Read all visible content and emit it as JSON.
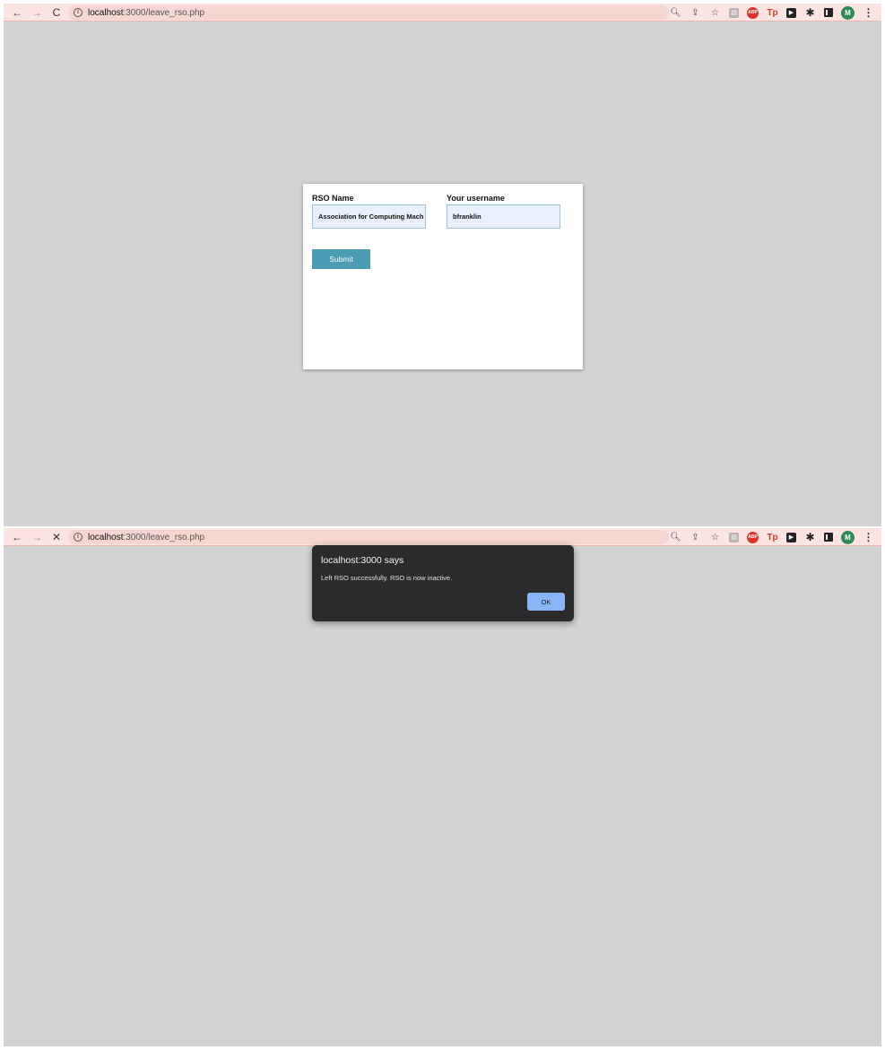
{
  "browser": {
    "url_host": "localhost",
    "url_path": ":3000/leave_rso.php",
    "avatar_letter": "M"
  },
  "form": {
    "rso_label": "RSO Name",
    "rso_value": "Association for Computing Mach",
    "username_label": "Your username",
    "username_value": "bfranklin",
    "submit_label": "Submit"
  },
  "alert": {
    "title": "localhost:3000 says",
    "message": "Left RSO successfully. RSO is now inactive.",
    "ok_label": "OK"
  },
  "icons": {
    "back": "arrow-left-icon",
    "forward": "arrow-right-icon",
    "reload": "reload-icon",
    "stop": "close-icon",
    "site_info": "info-icon",
    "zoom": "zoom-icon",
    "share": "share-icon",
    "bookmark": "star-icon"
  },
  "colors": {
    "toolbar_bg": "#fbe4e1",
    "page_bg": "#d3d3d3",
    "submit_bg": "#4b9cb3",
    "dialog_bg": "#2b2b2d",
    "ok_bg": "#8ab4f8"
  }
}
